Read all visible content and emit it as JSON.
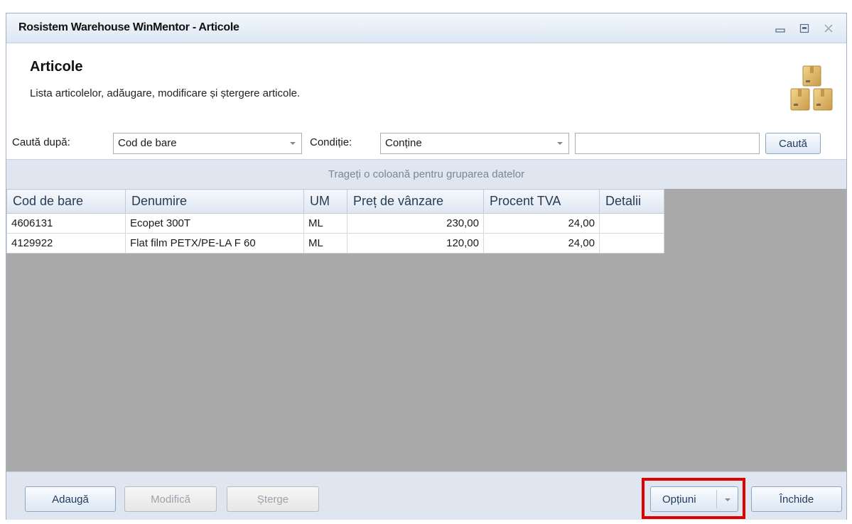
{
  "window": {
    "title": "Rosistem Warehouse WinMentor - Articole",
    "controls": [
      "minimize-icon",
      "restore-icon",
      "close-icon"
    ]
  },
  "header": {
    "title": "Articole",
    "description": "Lista articolelor, adăugare, modificare și ștergere articole.",
    "icon": "boxes-icon"
  },
  "search": {
    "search_by_label": "Caută după:",
    "search_by_value": "Cod de bare",
    "condition_label": "Condiție:",
    "condition_value": "Conține",
    "query_value": "",
    "search_button": "Caută"
  },
  "grid": {
    "group_hint": "Trageți o coloană pentru gruparea datelor",
    "columns": [
      "Cod de bare",
      "Denumire",
      "UM",
      "Preț de vânzare",
      "Procent TVA",
      "Detalii"
    ],
    "rows": [
      [
        "4606131",
        "Ecopet 300T",
        "ML",
        "230,00",
        "24,00",
        ""
      ],
      [
        "4129922",
        "Flat film PETX/PE-LA F 60",
        "ML",
        "120,00",
        "24,00",
        ""
      ]
    ]
  },
  "footer": {
    "add": "Adaugă",
    "modify": "Modifică",
    "delete": "Șterge",
    "options": "Opțiuni",
    "close": "Închide"
  },
  "colors": {
    "highlight": "#e00000",
    "grid_background": "#a9a9a9",
    "panel_background": "#dfe6ef"
  }
}
